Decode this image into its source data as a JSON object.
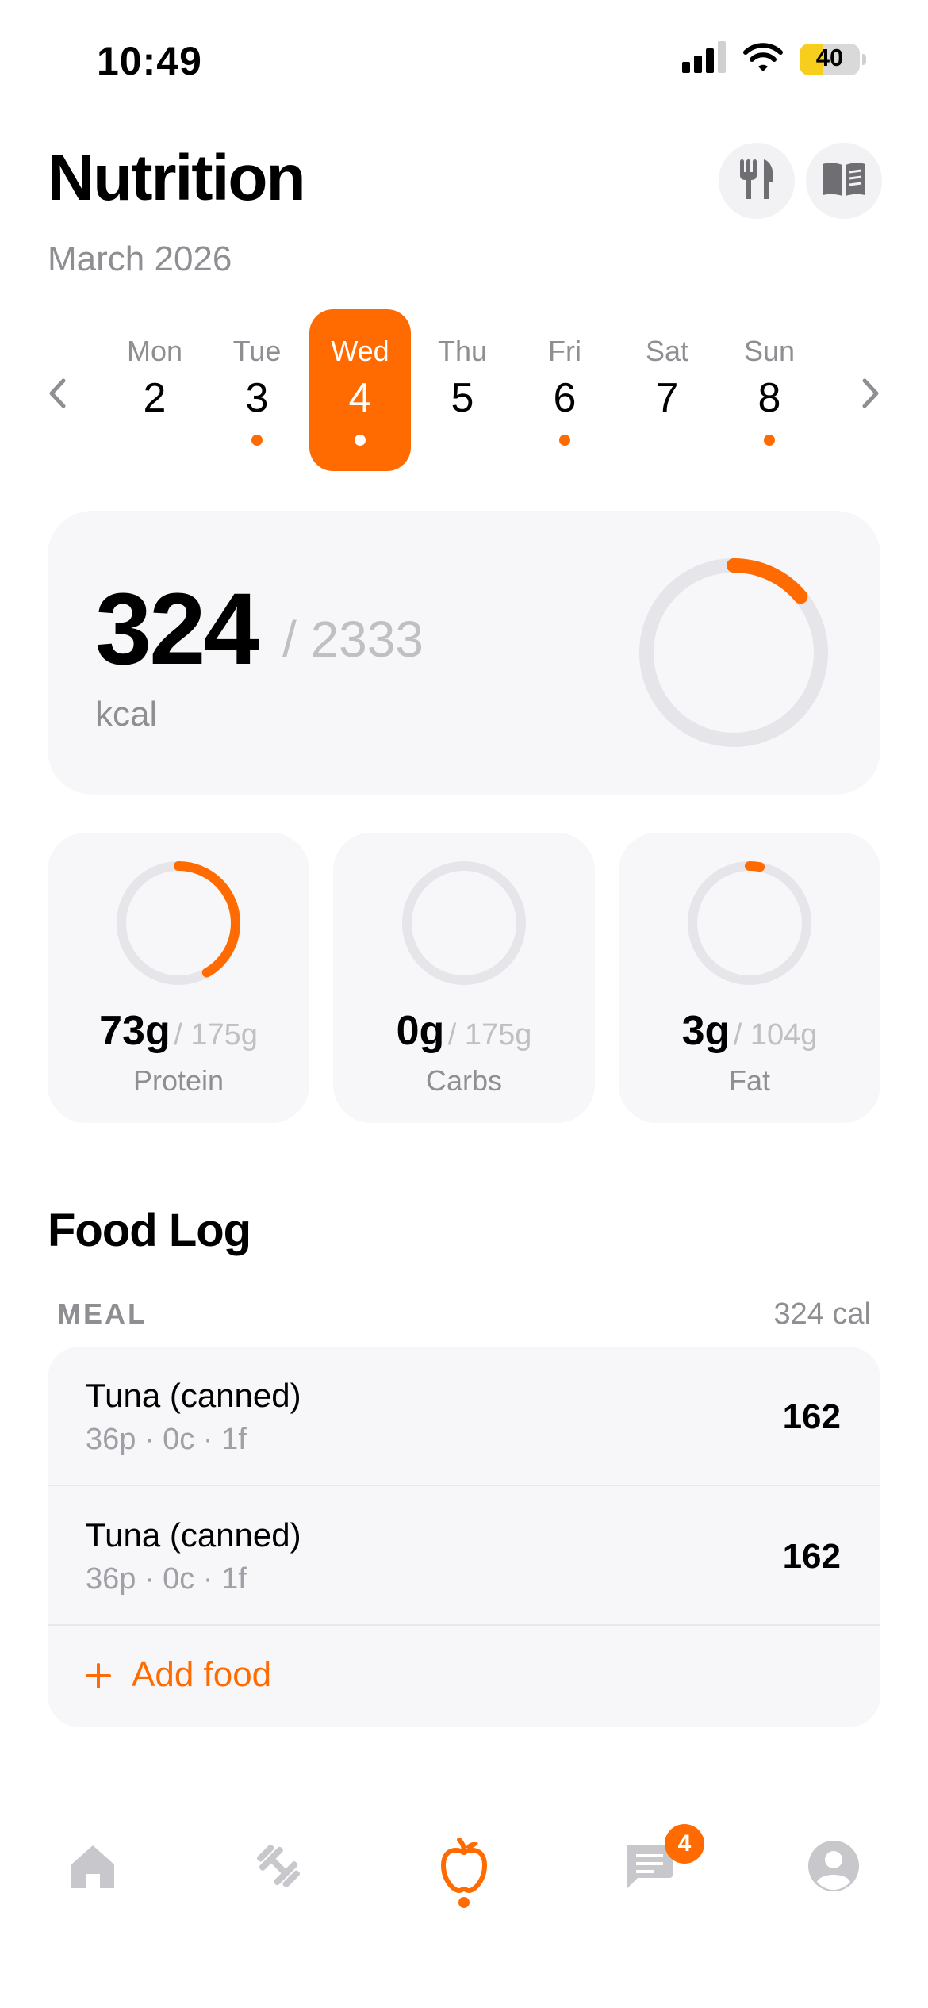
{
  "status_bar": {
    "time": "10:49",
    "battery": "40",
    "battery_level_percent": 40
  },
  "header": {
    "title": "Nutrition",
    "subtitle": "March 2026",
    "icons": [
      "utensils-icon",
      "book-icon"
    ]
  },
  "week": {
    "days": [
      {
        "name": "Mon",
        "num": "2",
        "logged": false,
        "selected": false
      },
      {
        "name": "Tue",
        "num": "3",
        "logged": true,
        "selected": false
      },
      {
        "name": "Wed",
        "num": "4",
        "logged": true,
        "selected": true
      },
      {
        "name": "Thu",
        "num": "5",
        "logged": false,
        "selected": false
      },
      {
        "name": "Fri",
        "num": "6",
        "logged": true,
        "selected": false
      },
      {
        "name": "Sat",
        "num": "7",
        "logged": false,
        "selected": false
      },
      {
        "name": "Sun",
        "num": "8",
        "logged": true,
        "selected": false
      }
    ]
  },
  "calories": {
    "value": "324",
    "goal": "/ 2333",
    "unit": "kcal",
    "progress": 0.139
  },
  "macros": {
    "protein": {
      "value": "73g",
      "goal": "/ 175g",
      "label": "Protein",
      "progress": 0.417
    },
    "carbs": {
      "value": "0g",
      "goal": "/ 175g",
      "label": "Carbs",
      "progress": 0.0
    },
    "fat": {
      "value": "3g",
      "goal": "/ 104g",
      "label": "Fat",
      "progress": 0.029
    }
  },
  "food_log": {
    "title": "Food Log",
    "meal_label": "MEAL",
    "meal_total": "324 cal",
    "items": [
      {
        "name": "Tuna (canned)",
        "macros": "36p · 0c · 1f",
        "calories": "162"
      },
      {
        "name": "Tuna (canned)",
        "macros": "36p · 0c · 1f",
        "calories": "162"
      }
    ],
    "add_label": "Add food"
  },
  "tab_bar": {
    "active": "nutrition",
    "messages_badge": "4",
    "icons": [
      "home-icon",
      "dumbbell-icon",
      "apple-icon",
      "chat-icon",
      "profile-icon"
    ]
  },
  "colors": {
    "accent": "#ff6b00",
    "track": "#e5e5ea",
    "card": "#f7f7f9",
    "muted": "#8e8e93"
  }
}
